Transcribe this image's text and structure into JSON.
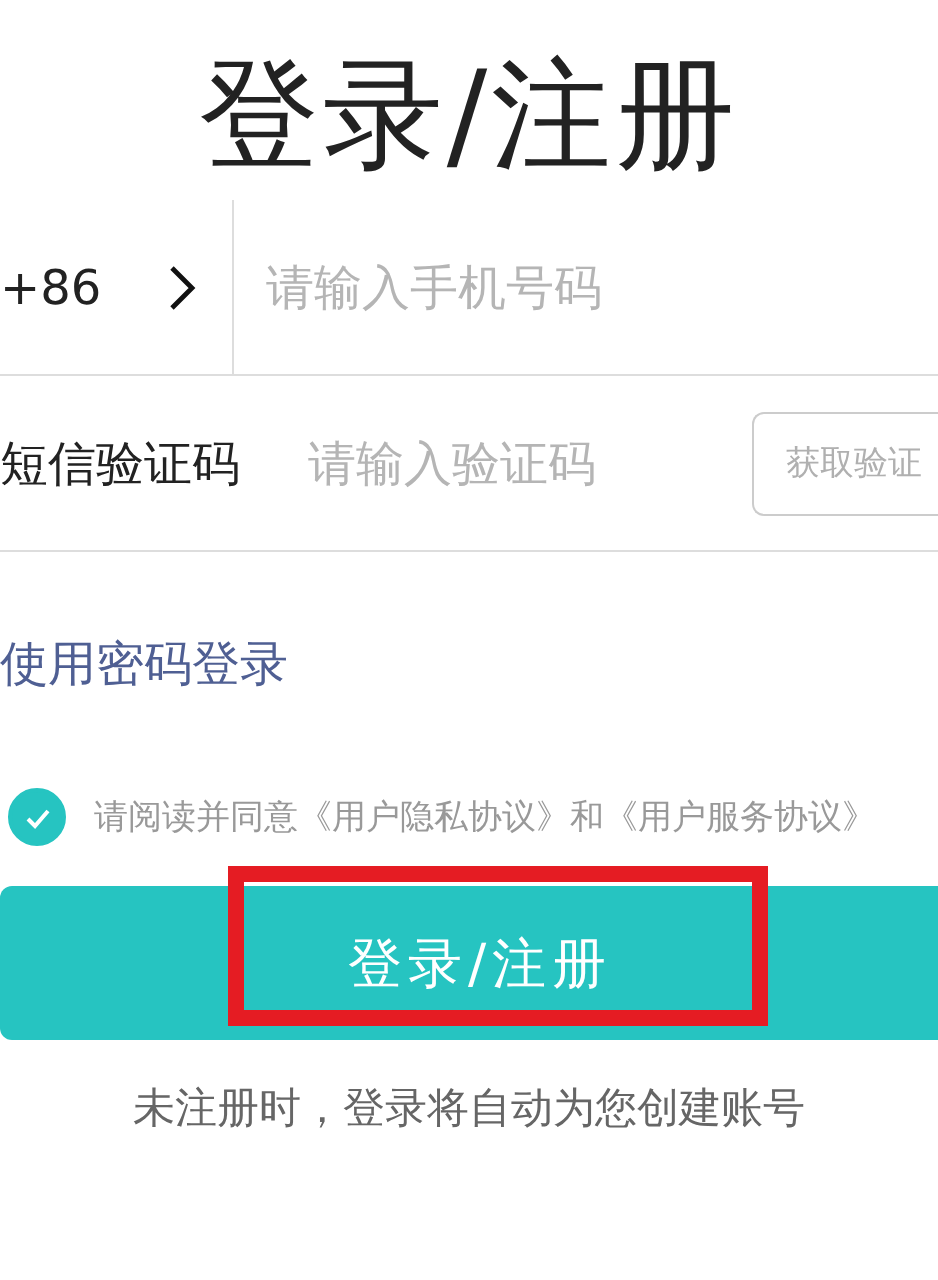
{
  "title": "登录/注册",
  "phone": {
    "country_code": "+86",
    "placeholder": "请输入手机号码"
  },
  "code": {
    "label": "短信验证码",
    "placeholder": "请输入验证码",
    "button": "获取验证"
  },
  "password_login_link": "使用密码登录",
  "agreement": {
    "checked": true,
    "text": "请阅读并同意《用户隐私协议》和《用户服务协议》"
  },
  "submit_button": {
    "label": "登录/注册",
    "highlighted": true
  },
  "footer_note": "未注册时，登录将自动为您创建账号"
}
